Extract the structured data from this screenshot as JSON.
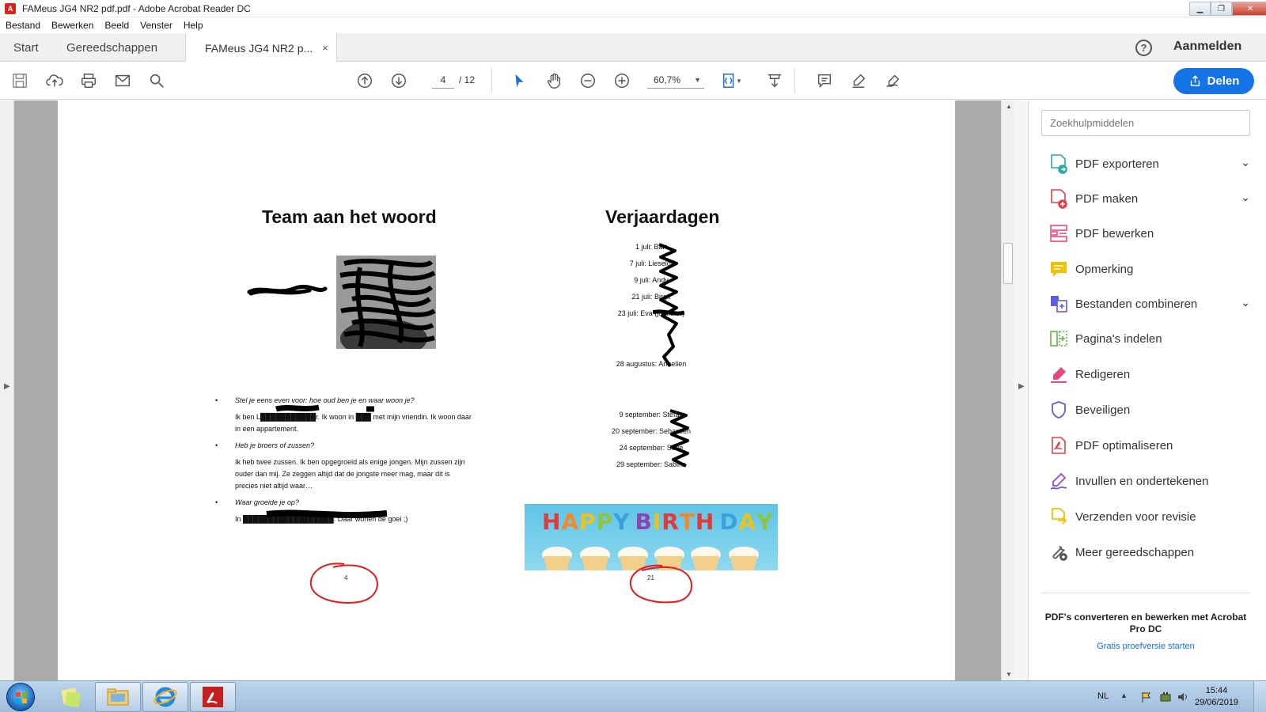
{
  "window": {
    "title": "FAMeus JG4 NR2 pdf.pdf - Adobe Acrobat Reader DC"
  },
  "menu": [
    "Bestand",
    "Bewerken",
    "Beeld",
    "Venster",
    "Help"
  ],
  "tabs": {
    "home": "Start",
    "tools": "Gereedschappen",
    "document": "FAMeus JG4 NR2 p...",
    "close": "×"
  },
  "header": {
    "help": "?",
    "signin": "Aanmelden"
  },
  "toolbar": {
    "current_page": "4",
    "page_total": "/ 12",
    "zoom": "60,7%",
    "share_label": "Delen"
  },
  "document": {
    "left_title": "Team aan het woord",
    "right_title": "Verjaardagen",
    "birthdays_july_aug": [
      "1 juli: Bart",
      "7 juli: Lieselot",
      "9 juli: Andy",
      "21 juli: Birgit",
      "23 juli: Eva (juf...ster)",
      "28 augustus: Annelien"
    ],
    "birthdays_september": [
      "9 september: Stefan",
      "20 september: Sebastien",
      "24 september: Sofie",
      "29 september: Sabina"
    ],
    "interview": [
      {
        "q": "Stel je eens even voor: hoe oud ben je en waar woon je?",
        "a": "Ik ben L███████████r. Ik woon in ███ met mijn vriendin. Ik woon daar in een appartement."
      },
      {
        "q": "Heb je broers of zussen?",
        "a": "Ik heb twee zussen. Ik ben opgegroeid als enige jongen. Mijn zussen zijn ouder dan mij. Ze zeggen altijd dat de jongste meer mag, maar dit is precies niet altijd waar…"
      },
      {
        "q": "Waar groeide je op?",
        "a": "In ██████████████████. Daar wonen de goei ;)"
      }
    ],
    "banner_text": "HAPPY BIRTHDAY",
    "left_page_number": "4",
    "right_page_number": "21"
  },
  "tools_pane": {
    "search_placeholder": "Zoekhulpmiddelen",
    "items": [
      {
        "label": "PDF exporteren",
        "icon": "export-pdf-icon",
        "color": "#2ba7a3",
        "expandable": true
      },
      {
        "label": "PDF maken",
        "icon": "create-pdf-icon",
        "color": "#e0424b",
        "expandable": true
      },
      {
        "label": "PDF bewerken",
        "icon": "edit-pdf-icon",
        "color": "#e5487e",
        "expandable": false
      },
      {
        "label": "Opmerking",
        "icon": "comment-icon",
        "color": "#f2c200",
        "expandable": false
      },
      {
        "label": "Bestanden combineren",
        "icon": "combine-files-icon",
        "color": "#5b5fdb",
        "expandable": true
      },
      {
        "label": "Pagina's indelen",
        "icon": "organize-pages-icon",
        "color": "#5fb83b",
        "expandable": false
      },
      {
        "label": "Redigeren",
        "icon": "redact-icon",
        "color": "#e5487e",
        "expandable": false
      },
      {
        "label": "Beveiligen",
        "icon": "protect-icon",
        "color": "#5b5fdb",
        "expandable": false
      },
      {
        "label": "PDF optimaliseren",
        "icon": "optimize-pdf-icon",
        "color": "#e0424b",
        "expandable": false
      },
      {
        "label": "Invullen en ondertekenen",
        "icon": "fill-sign-icon",
        "color": "#8b4fd6",
        "expandable": false
      },
      {
        "label": "Verzenden voor revisie",
        "icon": "send-review-icon",
        "color": "#f2c200",
        "expandable": false
      },
      {
        "label": "Meer gereedschappen",
        "icon": "more-tools-icon",
        "color": "#555555",
        "expandable": false
      }
    ],
    "promo_title": "PDF's converteren en bewerken met Acrobat Pro DC",
    "promo_link": "Gratis proefversie starten"
  },
  "taskbar": {
    "language": "NL",
    "time": "15:44",
    "date": "29/06/2019"
  }
}
